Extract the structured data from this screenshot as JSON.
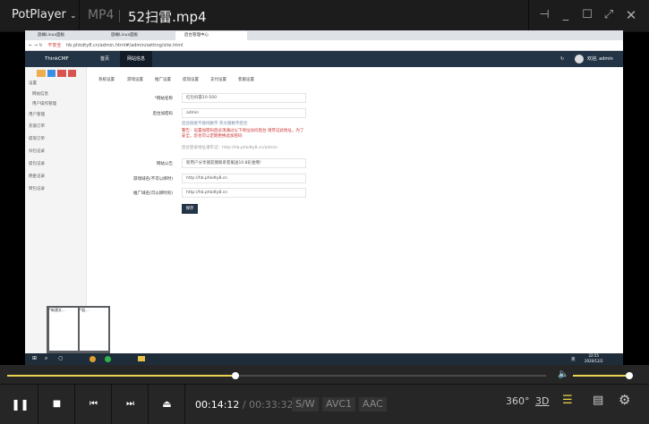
{
  "titlebar": {
    "app": "PotPlayer",
    "format": "MP4",
    "filename": "52扫雷.mp4"
  },
  "video": {
    "tabs": [
      "旋蝇Linux面板",
      "旋蝇Linux面板",
      "后台管理中心"
    ],
    "address": {
      "insecure": "不安全",
      "url": "hb.phkdty8.cn/admin.html#/admin/setting/site.html"
    },
    "nav": {
      "brand": "ThinkCMF",
      "items": [
        "首页",
        "网站信息"
      ],
      "user": "欢迎, admin"
    },
    "sidebar": [
      "设置",
      "网站信息",
      "用户操作管理",
      "用户管理",
      "充值订单",
      "提现订单",
      "扫包记录",
      "提包记录",
      "佣金记录",
      "转包记录"
    ],
    "subtabs": [
      "系统设置",
      "游戏设置",
      "推广设置",
      "提现设置",
      "支付设置",
      "客服设置"
    ],
    "form": {
      "site_name_label": "*网站名称",
      "site_name": "红包扫雷10-500",
      "admin_pw_label": "后台加密码",
      "admin_pw": "admin",
      "admin_hint": "后台链接不能纯数字 英文跟数字结合",
      "warning": "警告：设置加密码后必须通过以下地址访问后台 请劳记此地址，为了安全，您也可以定期更换此加密码",
      "admin_url": "后台登录地址请牢记：http://hb.phkdty8.cn/admin",
      "notice_label": "网站公告",
      "notice": "新用户分享朋友圈联系客服送10.8彩金哦!",
      "game_domain_label": "游戏域名(不可以绑时)",
      "game_domain": "http://hb.phkdty8.cn",
      "promo_domain_label": "推广域名(可以绑时的)",
      "promo_domain": "http://hb.phkdty8.cn",
      "save": "保存"
    },
    "thumbs": [
      "*新建文...",
      "*祖..."
    ],
    "tray": {
      "time": "22:55",
      "date": "2020/12/2",
      "ime": "英"
    }
  },
  "player": {
    "current": "00:14:12",
    "duration": "00:33:32",
    "progress": 0.4235,
    "volume": 0.95,
    "tags": [
      "S/W",
      "AVC1",
      "AAC"
    ],
    "right": [
      "360°",
      "3D"
    ],
    "accent": "#e8d44d"
  }
}
